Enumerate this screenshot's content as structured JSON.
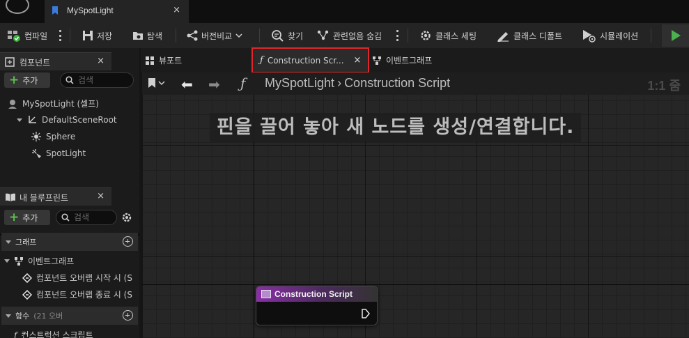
{
  "title_bar": {
    "doc_tab_label": "MySpotLight",
    "close": "×"
  },
  "toolbar": {
    "compile": "컴파일",
    "save": "저장",
    "browse": "탐색",
    "diff": "버전비교",
    "find": "찾기",
    "hide_unrelated": "관련없음 숨김",
    "class_settings": "클래스 세팅",
    "class_defaults": "클래스 디폴트",
    "simulation": "시뮬레이션",
    "accent_play": "#4caf50"
  },
  "components_panel": {
    "tab_label": "컴포넌트",
    "close": "×",
    "add_label": "추가",
    "search_placeholder": "검색",
    "tree": [
      {
        "label": "MySpotLight (셀프)",
        "icon": "actor-icon"
      },
      {
        "label": "DefaultSceneRoot",
        "icon": "scene-root-icon"
      },
      {
        "label": "Sphere",
        "icon": "light-icon"
      },
      {
        "label": "SpotLight",
        "icon": "spotlight-icon"
      }
    ]
  },
  "blueprint_panel": {
    "tab_label": "내 블루프린트",
    "close": "×",
    "add_label": "추가",
    "search_placeholder": "검색",
    "graphs_header": "그래프",
    "event_graph": "이벤트그래프",
    "events": [
      "컴포넌트 오버랩 시작 시 (S",
      "컴포넌트 오버랩 종료 시 (S"
    ],
    "functions_header": "함수",
    "functions_count": "(21 오버",
    "construction_script": "컨스트럭션 스크립트"
  },
  "graph_tabs": {
    "viewport": "뷰포트",
    "construction_script": "Construction Scr...",
    "close": "×",
    "event_graph": "이벤트그래프"
  },
  "graph": {
    "breadcrumb_root": "MySpotLight",
    "breadcrumb_leaf": "Construction Script",
    "zoom": "1:1 줌",
    "hint": "핀을 끌어 놓아 새 노드를 생성/연결합니다.",
    "node_title": "Construction Script",
    "node_color": "#8a2fa6"
  }
}
